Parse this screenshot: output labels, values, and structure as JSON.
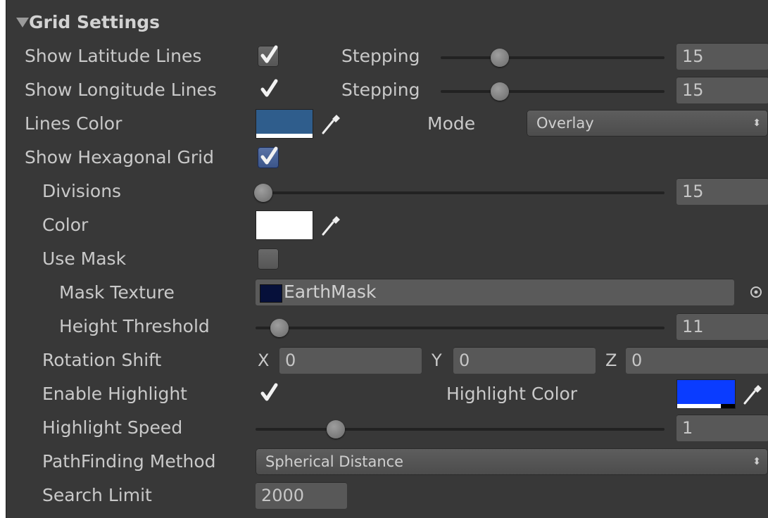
{
  "section": {
    "title": "Grid Settings"
  },
  "latitude": {
    "label": "Show Latitude Lines",
    "checked": true,
    "stepping_label": "Stepping",
    "stepping_value": "15",
    "slider_fraction": 0.27
  },
  "longitude": {
    "label": "Show Longitude Lines",
    "checked": true,
    "stepping_label": "Stepping",
    "stepping_value": "15",
    "slider_fraction": 0.27
  },
  "lines_color": {
    "label": "Lines Color",
    "color": "#2f5d8c",
    "mode_label": "Mode",
    "mode_value": "Overlay"
  },
  "hexagonal": {
    "label": "Show Hexagonal Grid",
    "checked": true
  },
  "divisions": {
    "label": "Divisions",
    "value": "15",
    "slider_fraction": 0.0
  },
  "hex_color": {
    "label": "Color",
    "color": "#ffffff"
  },
  "use_mask": {
    "label": "Use Mask",
    "checked": false
  },
  "mask_texture": {
    "label": "Mask Texture",
    "value": "EarthMask"
  },
  "height_threshold": {
    "label": "Height Threshold",
    "value": "11",
    "slider_fraction": 0.04
  },
  "rotation_shift": {
    "label": "Rotation Shift",
    "x_label": "X",
    "x_value": "0",
    "y_label": "Y",
    "y_value": "0",
    "z_label": "Z",
    "z_value": "0"
  },
  "highlight": {
    "label": "Enable Highlight",
    "checked": true,
    "color_label": "Highlight Color",
    "color": "#0a3cff"
  },
  "highlight_speed": {
    "label": "Highlight Speed",
    "value": "1",
    "slider_fraction": 0.18
  },
  "pathfinding": {
    "label": "PathFinding Method",
    "value": "Spherical Distance"
  },
  "search_limit": {
    "label": "Search Limit",
    "value": "2000"
  },
  "colors": {
    "panel_bg": "#383838",
    "field_bg": "#585858",
    "text": "#c9c9c9"
  }
}
